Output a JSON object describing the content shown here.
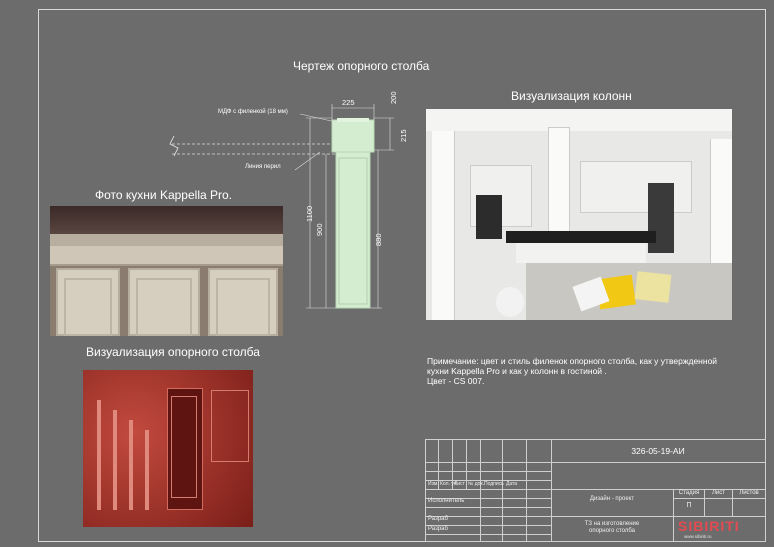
{
  "drawing": {
    "title": "Чертеж опорного столба",
    "mdf_label": "МДФ с филенкой  (18 мм)",
    "rail_label": "Линия перил",
    "dim_width": "225",
    "dim_top": "200",
    "dim_cap": "215",
    "dim_total": "1100",
    "dim_rail": "900",
    "dim_body": "880"
  },
  "photo_kitchen": {
    "title": "Фото кухни Kappella Pro."
  },
  "viz_post": {
    "title": "Визуализация опорного столба"
  },
  "viz_columns": {
    "title": "Визуализация колонн"
  },
  "note": {
    "line1": "Примечание: цвет и стиль филенок опорного столба, как у утвержденной",
    "line2": "кухни Kappella Pro и как у колонн в гостиной .",
    "line3": "Цвет - CS 007."
  },
  "title_block": {
    "code": "326-05-19-АИ",
    "col_izm": "Изм.",
    "col_kol": "Кол. уч.",
    "col_list": "Лист",
    "col_ndoc": "№ док.",
    "col_podp": "Подпись",
    "col_data": "Дата",
    "ispolnitel": "Исполнитель",
    "razrab1": "Разраб",
    "razrab2": "Разраб",
    "project": "Дизайн - проект",
    "stadia": "Стадия",
    "list": "Лист",
    "listov": "Листов",
    "stadia_val": "П",
    "doc_title_1": "ТЗ на изготовление",
    "doc_title_2": "опорного столба",
    "logo": "SIBIRITI",
    "logo_url": "www.sibiriti.ru"
  }
}
